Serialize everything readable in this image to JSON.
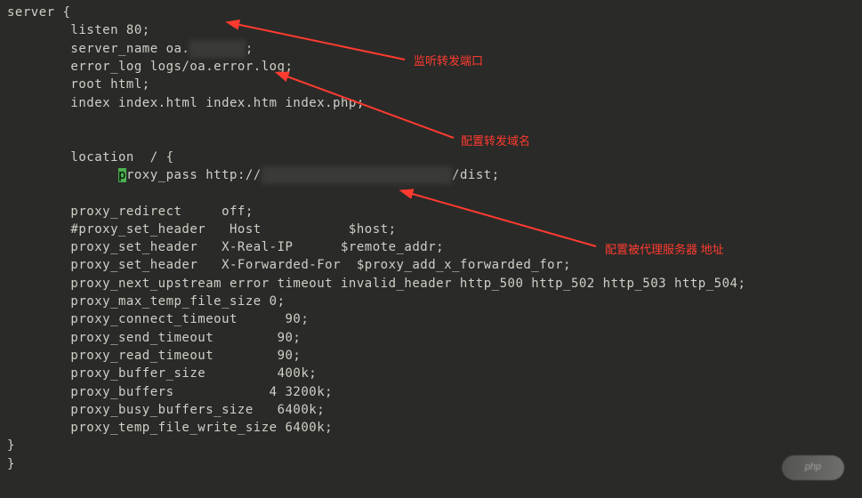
{
  "code": {
    "l1": "server {",
    "l2": "        listen 80;",
    "l3a": "        server_name oa.",
    "l3b": ";",
    "l4": "        error_log logs/oa.error.log;",
    "l5": "        root html;",
    "l6": "        index index.html index.htm index.php;",
    "l7": "",
    "l8": "",
    "l9": "        location  / {",
    "l10a": "              ",
    "l10_cursor": "p",
    "l10b": "roxy_pass http://",
    "l10c": "/dist;",
    "l11": "",
    "l12": "        proxy_redirect     off;",
    "l13": "        #proxy_set_header   Host           $host;",
    "l14": "        proxy_set_header   X-Real-IP      $remote_addr;",
    "l15": "        proxy_set_header   X-Forwarded-For  $proxy_add_x_forwarded_for;",
    "l16": "        proxy_next_upstream error timeout invalid_header http_500 http_502 http_503 http_504;",
    "l17": "        proxy_max_temp_file_size 0;",
    "l18": "        proxy_connect_timeout      90;",
    "l19": "        proxy_send_timeout        90;",
    "l20": "        proxy_read_timeout        90;",
    "l21": "        proxy_buffer_size         400k;",
    "l22": "        proxy_buffers            4 3200k;",
    "l23": "        proxy_busy_buffers_size   6400k;",
    "l24": "        proxy_temp_file_write_size 6400k;",
    "l25": "}",
    "l26": "}",
    "blur1": "       ",
    "blur2": "                        "
  },
  "annotations": {
    "a1": "监听转发端口",
    "a2": "配置转发域名",
    "a3": "配置被代理服务器 地址"
  },
  "watermark": "php"
}
